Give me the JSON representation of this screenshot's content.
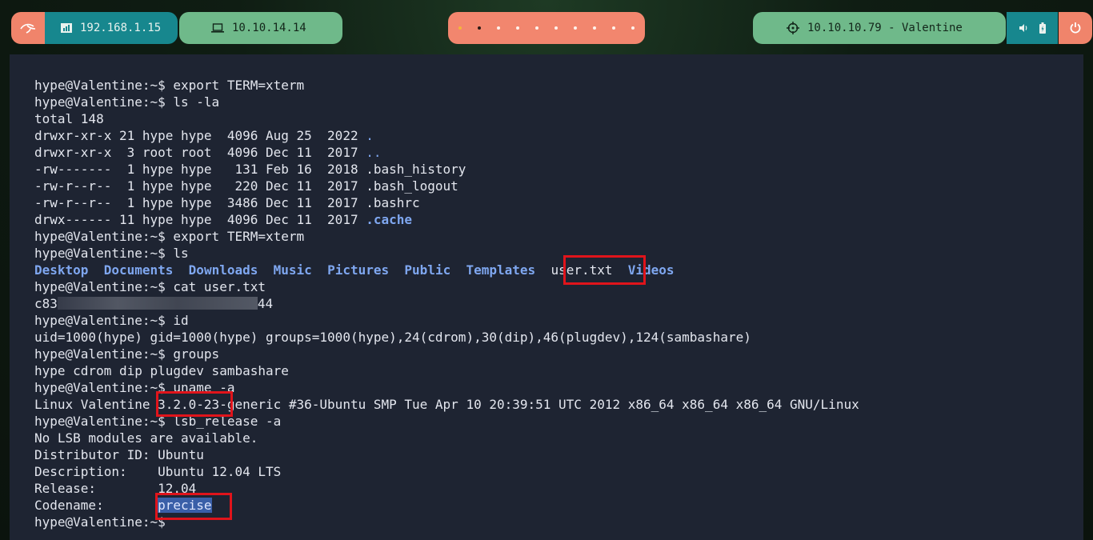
{
  "topbar": {
    "local_ip": "192.168.1.15",
    "vpn_ip": "10.10.14.14",
    "target": "10.10.10.79 - Valentine",
    "workspaces": 10
  },
  "terminal": {
    "lines": [
      {
        "t": "hype@Valentine:~$ export TERM=xterm"
      },
      {
        "t": "hype@Valentine:~$ ls -la"
      },
      {
        "t": "total 148"
      },
      {
        "t": "drwxr-xr-x 21 hype hype  4096 Aug 25  2022 ",
        "link": "."
      },
      {
        "t": "drwxr-xr-x  3 root root  4096 Dec 11  2017 ",
        "link": ".."
      },
      {
        "t": "-rw-------  1 hype hype   131 Feb 16  2018 .bash_history"
      },
      {
        "t": "-rw-r--r--  1 hype hype   220 Dec 11  2017 .bash_logout"
      },
      {
        "t": "-rw-r--r--  1 hype hype  3486 Dec 11  2017 .bashrc"
      },
      {
        "t": "drwx------ 11 hype hype  4096 Dec 11  2017 ",
        "dir": ".cache"
      },
      {
        "t": "hype@Valentine:~$ export TERM=xterm"
      },
      {
        "t": "hype@Valentine:~$ ls"
      }
    ],
    "ls_dirs": [
      "Desktop",
      "Documents",
      "Downloads",
      "Music",
      "Pictures",
      "Public",
      "Templates"
    ],
    "ls_file": "user.txt",
    "ls_last": "Videos",
    "cat_cmd": "hype@Valentine:~$ cat user.txt",
    "hash_start": "c83",
    "hash_end": "44",
    "rest": [
      "hype@Valentine:~$ id",
      "uid=1000(hype) gid=1000(hype) groups=1000(hype),24(cdrom),30(dip),46(plugdev),124(sambashare)",
      "hype@Valentine:~$ groups",
      "hype cdrom dip plugdev sambashare",
      "hype@Valentine:~$ uname -a",
      "Linux Valentine 3.2.0-23-generic #36-Ubuntu SMP Tue Apr 10 20:39:51 UTC 2012 x86_64 x86_64 x86_64 GNU/Linux",
      "hype@Valentine:~$ lsb_release -a",
      "No LSB modules are available.",
      "Distributor ID: Ubuntu",
      "Description:    Ubuntu 12.04 LTS",
      "Release:        12.04"
    ],
    "codename_label": "Codename:       ",
    "codename_value": "precise",
    "last_prompt": "hype@Valentine:~$"
  }
}
